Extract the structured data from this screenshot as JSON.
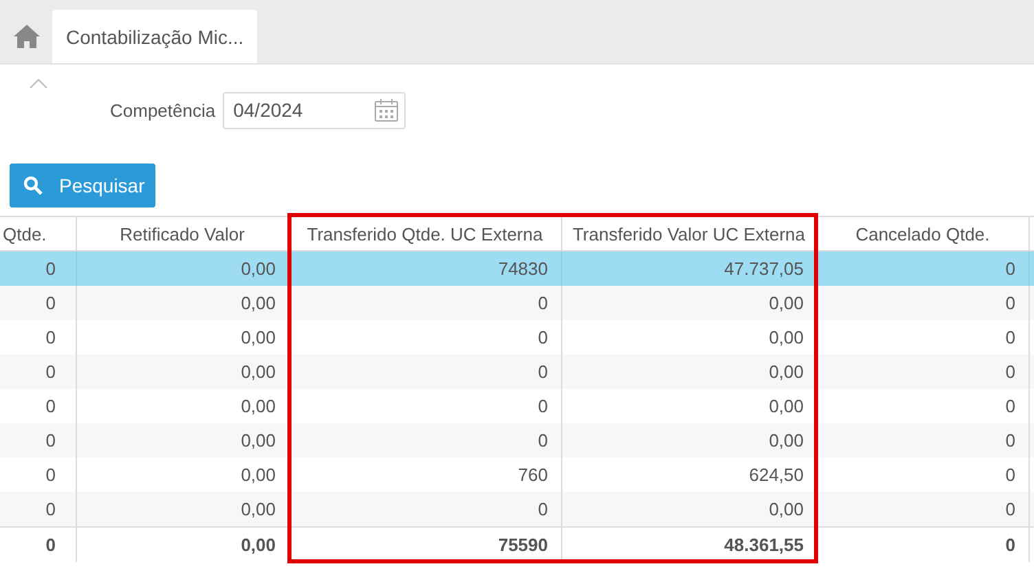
{
  "tabs": [
    {
      "label": "Contabilização Mic...",
      "selected": true
    }
  ],
  "filter": {
    "label": "Competência",
    "value": "04/2024"
  },
  "search_button": {
    "label": "Pesquisar"
  },
  "table": {
    "columns": [
      {
        "label": "Qtde.",
        "highlighted": false
      },
      {
        "label": "Retificado Valor",
        "highlighted": false
      },
      {
        "label": "Transferido Qtde. UC Externa",
        "highlighted": true
      },
      {
        "label": "Transferido Valor UC Externa",
        "highlighted": true
      },
      {
        "label": "Cancelado Qtde.",
        "highlighted": false
      }
    ],
    "rows": [
      {
        "cells": [
          "0",
          "0,00",
          "74830",
          "47.737,05",
          "0"
        ],
        "selected": true
      },
      {
        "cells": [
          "0",
          "0,00",
          "0",
          "0,00",
          "0"
        ],
        "selected": false
      },
      {
        "cells": [
          "0",
          "0,00",
          "0",
          "0,00",
          "0"
        ],
        "selected": false
      },
      {
        "cells": [
          "0",
          "0,00",
          "0",
          "0,00",
          "0"
        ],
        "selected": false
      },
      {
        "cells": [
          "0",
          "0,00",
          "0",
          "0,00",
          "0"
        ],
        "selected": false
      },
      {
        "cells": [
          "0",
          "0,00",
          "0",
          "0,00",
          "0"
        ],
        "selected": false
      },
      {
        "cells": [
          "0",
          "0,00",
          "760",
          "624,50",
          "0"
        ],
        "selected": false
      },
      {
        "cells": [
          "0",
          "0,00",
          "0",
          "0,00",
          "0"
        ],
        "selected": false
      }
    ],
    "totals": [
      "0",
      "0,00",
      "75590",
      "48.361,55",
      "0"
    ]
  }
}
